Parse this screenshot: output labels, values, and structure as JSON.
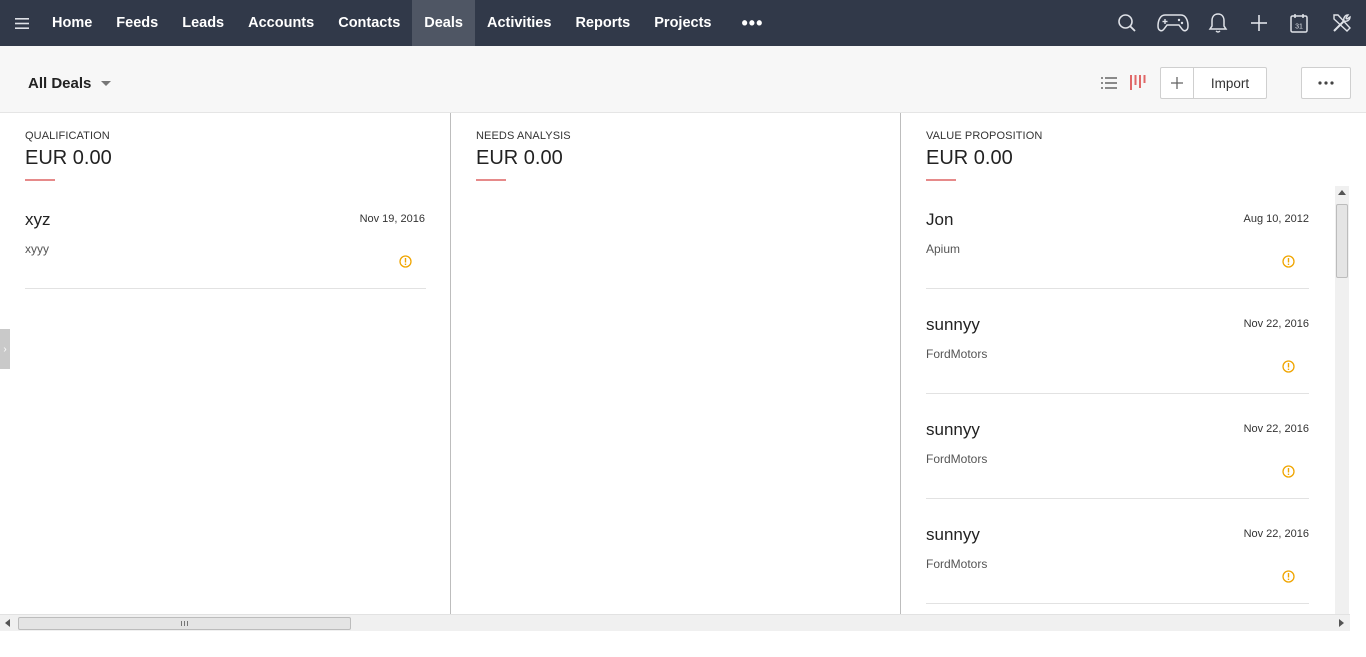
{
  "nav": {
    "tabs": [
      {
        "label": "Home",
        "active": false
      },
      {
        "label": "Feeds",
        "active": false
      },
      {
        "label": "Leads",
        "active": false
      },
      {
        "label": "Accounts",
        "active": false
      },
      {
        "label": "Contacts",
        "active": false
      },
      {
        "label": "Deals",
        "active": true
      },
      {
        "label": "Activities",
        "active": false
      },
      {
        "label": "Reports",
        "active": false
      },
      {
        "label": "Projects",
        "active": false
      }
    ],
    "more_label": "•••",
    "icons": [
      "search-icon",
      "gamepad-icon",
      "bell-icon",
      "plus-icon",
      "calendar-icon",
      "tools-icon"
    ],
    "calendar_day": "31"
  },
  "toolbar": {
    "view_label": "All Deals",
    "import_label": "Import",
    "more_label": "•••"
  },
  "colors": {
    "nav_bg": "#313949",
    "nav_active": "#4f5664",
    "accent": "#e68a8a",
    "warning": "#f0a500"
  },
  "columns": [
    {
      "stage": "QUALIFICATION",
      "amount": "EUR 0.00",
      "cards": [
        {
          "name": "xyz",
          "date": "Nov 19, 2016",
          "account": "xyyy"
        }
      ]
    },
    {
      "stage": "NEEDS ANALYSIS",
      "amount": "EUR 0.00",
      "cards": []
    },
    {
      "stage": "VALUE PROPOSITION",
      "amount": "EUR 0.00",
      "cards": [
        {
          "name": "Jon",
          "date": "Aug 10, 2012",
          "account": "Apium"
        },
        {
          "name": "sunnyy",
          "date": "Nov 22, 2016",
          "account": "FordMotors"
        },
        {
          "name": "sunnyy",
          "date": "Nov 22, 2016",
          "account": "FordMotors"
        },
        {
          "name": "sunnyy",
          "date": "Nov 22, 2016",
          "account": "FordMotors"
        }
      ]
    }
  ]
}
